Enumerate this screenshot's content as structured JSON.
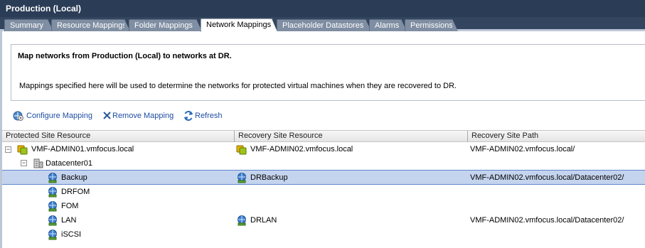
{
  "window": {
    "title": "Production (Local)"
  },
  "tabs": [
    {
      "label": "Summary",
      "active": false
    },
    {
      "label": "Resource Mappings",
      "active": false
    },
    {
      "label": "Folder Mappings",
      "active": false
    },
    {
      "label": "Network Mappings",
      "active": true
    },
    {
      "label": "Placeholder Datastores",
      "active": false
    },
    {
      "label": "Alarms",
      "active": false
    },
    {
      "label": "Permissions",
      "active": false
    }
  ],
  "info": {
    "title": "Map networks from Production (Local) to networks at DR.",
    "description": "Mappings specified here will be used to determine the networks for protected virtual machines when they are recovered to DR."
  },
  "toolbar": {
    "configure_label": "Configure Mapping",
    "remove_label": "Remove Mapping",
    "refresh_label": "Refresh"
  },
  "grid": {
    "columns": [
      "Protected Site Resource",
      "Recovery Site Resource",
      "Recovery Site Path"
    ],
    "rows": [
      {
        "protected": "VMF-ADMIN01.vmfocus.local",
        "recovery": "VMF-ADMIN02.vmfocus.local",
        "path": "VMF-ADMIN02.vmfocus.local/",
        "icon": "vcenter-icon",
        "expander": "−"
      },
      {
        "protected": "Datacenter01",
        "recovery": "",
        "path": "",
        "icon": "datacenter-icon",
        "expander": "−"
      },
      {
        "protected": "Backup",
        "recovery": "DRBackup",
        "path": "VMF-ADMIN02.vmfocus.local/Datacenter02/",
        "icon": "network-icon",
        "selected": true
      },
      {
        "protected": "DRFOM",
        "recovery": "",
        "path": "",
        "icon": "network-icon"
      },
      {
        "protected": "FOM",
        "recovery": "",
        "path": "",
        "icon": "network-icon"
      },
      {
        "protected": "LAN",
        "recovery": "DRLAN",
        "path": "VMF-ADMIN02.vmfocus.local/Datacenter02/",
        "icon": "network-icon"
      },
      {
        "protected": "iSCSI",
        "recovery": "",
        "path": "",
        "icon": "network-icon"
      }
    ]
  },
  "colors": {
    "title_bar": "#2b3c56",
    "tab_inactive": "#7f8ea2",
    "selection": "#c5d4ee",
    "link": "#1f4ea3"
  }
}
